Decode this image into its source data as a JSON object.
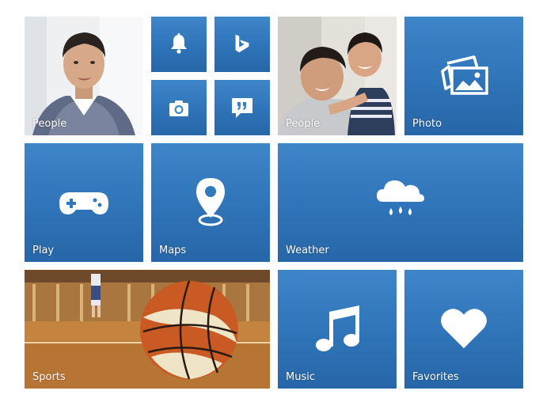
{
  "tiles": {
    "people_1": {
      "label": "People",
      "icon": "person-photo"
    },
    "notifications": {
      "icon": "bell-icon"
    },
    "bing": {
      "icon": "bing-icon"
    },
    "camera": {
      "icon": "camera-icon"
    },
    "quotes": {
      "icon": "quote-icon"
    },
    "people_2": {
      "label": "People",
      "icon": "family-photo"
    },
    "photo": {
      "label": "Photo",
      "icon": "photos-icon"
    },
    "play": {
      "label": "Play",
      "icon": "gamepad-icon"
    },
    "maps": {
      "label": "Maps",
      "icon": "map-pin-icon"
    },
    "weather": {
      "label": "Weather",
      "icon": "rain-cloud-icon"
    },
    "sports": {
      "label": "Sports",
      "icon": "basketball-photo"
    },
    "music": {
      "label": "Music",
      "icon": "music-note-icon"
    },
    "favorites": {
      "label": "Favorites",
      "icon": "heart-icon"
    }
  },
  "colors": {
    "tile_top": "#3d86c8",
    "tile_bottom": "#2766a8",
    "label": "#ffffff",
    "background": "#ffffff"
  }
}
